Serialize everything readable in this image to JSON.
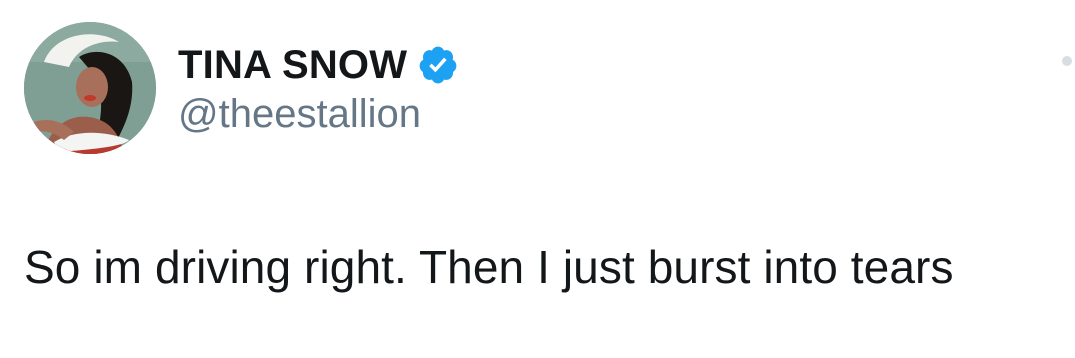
{
  "tweet": {
    "author": {
      "display_name": "TINA SNOW",
      "handle": "@theestallion",
      "verified": true,
      "avatar_icon": "profile-avatar-image",
      "verified_icon": "verified-badge-icon",
      "verified_color": "#1da1f2"
    },
    "text": "So im driving right. Then I just burst into tears"
  }
}
